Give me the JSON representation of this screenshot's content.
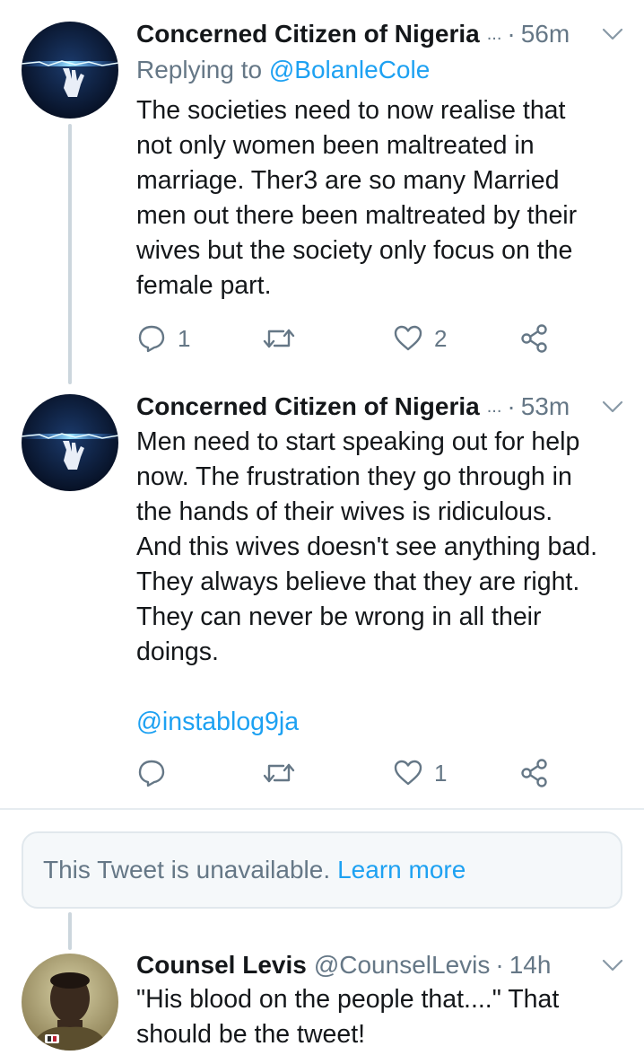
{
  "tweets": [
    {
      "name": "Concerned Citizen of Nigeria",
      "ellipsis": "...",
      "dot": "·",
      "time": "56m",
      "replying_prefix": "Replying to",
      "replying_handle": "@BolanleCole",
      "text": "The societies need to now realise that\nnot only women been maltreated in\nmarriage. Ther3 are so many Married\nmen out there been maltreated by their\nwives but the society only focus on the\nfemale part.",
      "replies": "1",
      "retweets": "",
      "likes": "2",
      "avatar_icon": "lightning-hand-icon"
    },
    {
      "name": "Concerned Citizen of Nigeria",
      "ellipsis": "...",
      "dot": "·",
      "time": "53m",
      "text": "Men need to start speaking out for help\nnow. The frustration they go through in\nthe hands of their wives is ridiculous.\nAnd this wives doesn't see anything bad.\nThey always believe that they are right.\nThey can never be wrong in all their\ndoings.",
      "mention": "@instablog9ja",
      "replies": "",
      "retweets": "",
      "likes": "1",
      "avatar_icon": "lightning-hand-icon"
    },
    {
      "name": "Counsel Levis",
      "handle": "@CounselLevis",
      "dot": "·",
      "time": "14h",
      "text": "\"His blood on the people that....\" That\nshould be the tweet!",
      "avatar_icon": "person-photo-icon"
    }
  ],
  "unavailable": {
    "text": "This Tweet is unavailable.",
    "learn_more": "Learn more"
  },
  "colors": {
    "accent": "#1da1f2",
    "secondary_text": "#657786",
    "primary_text": "#14171a",
    "thread_line": "#ccd6dd"
  }
}
